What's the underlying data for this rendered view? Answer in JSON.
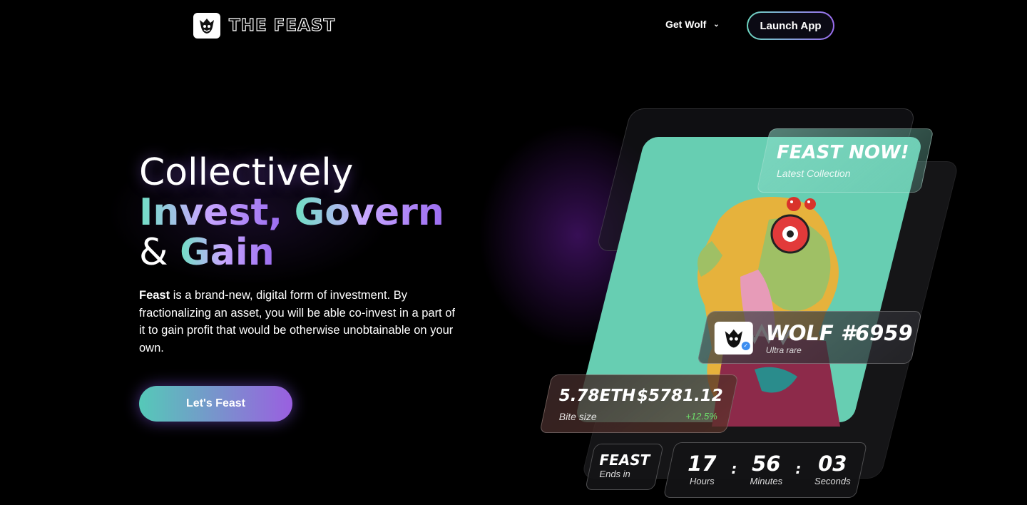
{
  "nav": {
    "brand": "THE FEAST",
    "get_wolf": "Get Wolf",
    "launch_app": "Launch App"
  },
  "hero": {
    "line1": "Collectively",
    "line2_a": "Invest,",
    "line2_b": "Govern",
    "line3_amp": "&",
    "line3_b": "Gain",
    "desc_bold": "Feast",
    "desc_rest": " is a brand-new, digital form of investment. By fractionalizing an asset, you will be able co-invest in a part of it to gain profit that would be otherwise unobtainable on your own.",
    "cta": "Let's Feast"
  },
  "showcase": {
    "feast_now": "FEAST NOW!",
    "latest_collection": "Latest Collection",
    "wolf_title": "WOLF #6959",
    "wolf_rarity": "Ultra rare",
    "eth": "5.78ETH",
    "usd": "$5781.12",
    "bite_size": "Bite size",
    "change": "+12.5%",
    "ends_title": "FEAST",
    "ends_sub": "Ends in",
    "timer": {
      "hours": "17",
      "minutes": "56",
      "seconds": "03",
      "hours_label": "Hours",
      "minutes_label": "Minutes",
      "seconds_label": "Seconds",
      "sep": ":"
    }
  },
  "colors": {
    "mint": "#67ceb2",
    "purple": "#9b6cf0",
    "positive": "#6ee06a"
  }
}
